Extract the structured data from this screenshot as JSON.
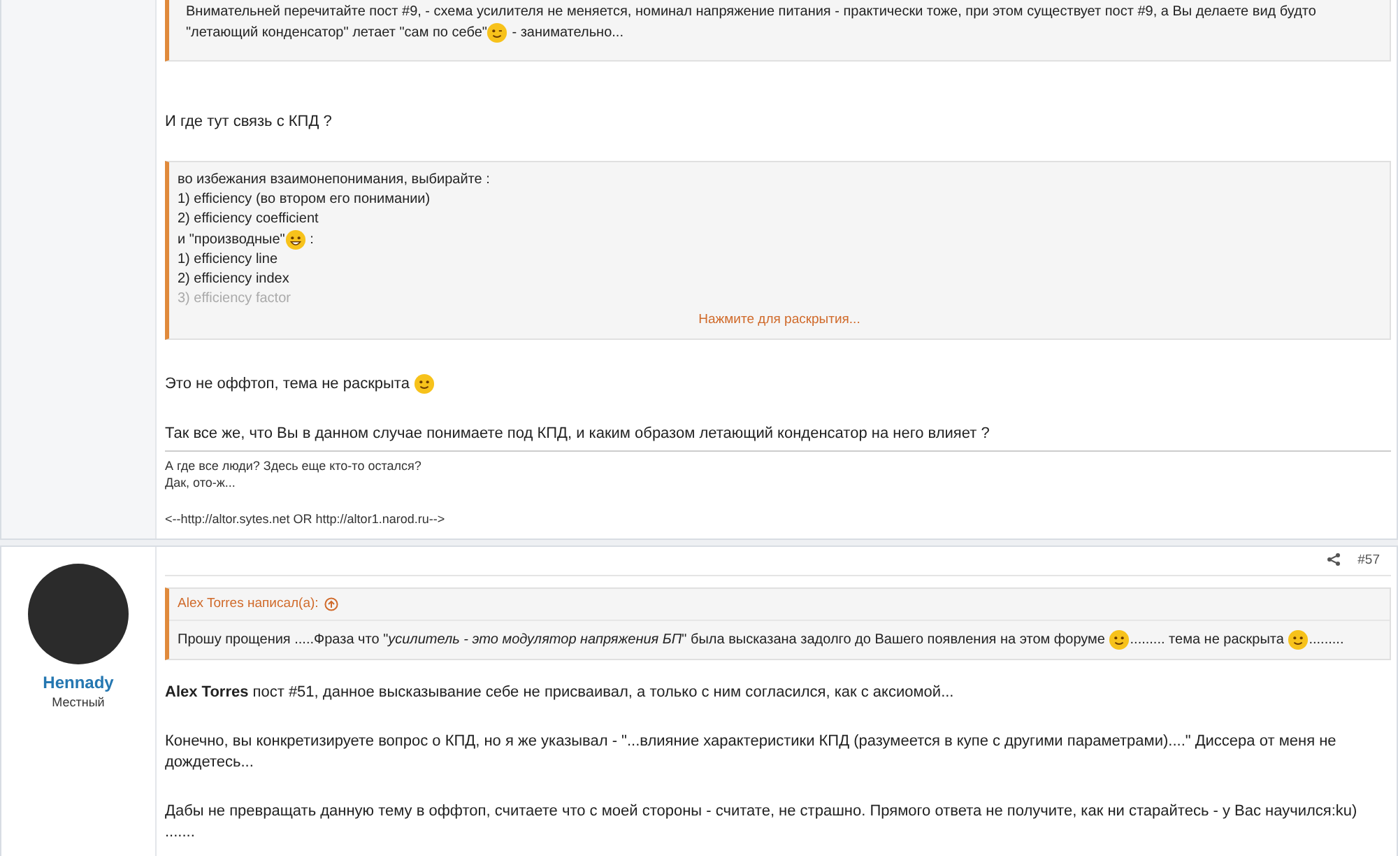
{
  "posts": [
    {
      "kind": "continued",
      "blocks": [
        {
          "kind": "quote",
          "paragraphs": [
            [
              {
                "kind": "text",
                "text": "Внимательней перечитайте пост #9, - схема усилителя не меняется, номинал напряжение питания - практически тоже, при этом существует пост #9, а Вы делаете вид будто \"летающий конденсатор\" летает \"сам по себе\""
              },
              {
                "kind": "wink"
              },
              {
                "kind": "text",
                "text": " - занимательно..."
              }
            ]
          ]
        },
        {
          "kind": "text",
          "paragraphs": [
            [
              {
                "kind": "text",
                "text": "И где тут связь с КПД ?"
              }
            ]
          ]
        },
        {
          "kind": "expandable",
          "expanded": false,
          "expander": "Нажмите для раскрытия...",
          "paragraphs": [
            [
              {
                "kind": "text",
                "text": "во избежания взаимонепонимания, выбирайте :"
              }
            ],
            [
              {
                "kind": "text",
                "text": "1) efficiency (во втором его понимании)"
              }
            ],
            [
              {
                "kind": "text",
                "text": "2) efficiency coefficient"
              }
            ],
            [
              {
                "kind": "text",
                "text": "и \"производные\""
              },
              {
                "kind": "grin"
              },
              {
                "kind": "text",
                "text": " :"
              }
            ],
            [
              {
                "kind": "text",
                "text": "1) efficiency line"
              }
            ],
            [
              {
                "kind": "text",
                "text": "2) efficiency index"
              }
            ],
            [
              {
                "kind": "text",
                "text": "3) efficiency factor"
              }
            ]
          ]
        },
        {
          "kind": "text",
          "paragraphs": [
            [
              {
                "kind": "text",
                "text": "Это не оффтоп, тема не раскрыта "
              },
              {
                "kind": "smile"
              }
            ],
            [
              {
                "kind": "text",
                "text": "Так все же, что Вы в данном случае понимаете под КПД, и каким образом летающий конденсатор на него влияет ?"
              }
            ]
          ]
        }
      ],
      "signature": [
        [
          "А где все люди? Здесь еще кто-то остался?",
          "Дак, ото-ж..."
        ],
        [
          "<--http://altor.sytes.net OR http://altor1.narod.ru-->"
        ]
      ]
    },
    {
      "kind": "full",
      "author": "Hennady",
      "rank": "Местный",
      "number": "#57",
      "blocks": [
        {
          "kind": "quote",
          "attribution": "Alex Torres написал(а):",
          "paragraphs": [
            [
              {
                "kind": "text",
                "text": "Прошу прощения .....Фраза что \"*усилитель - это модулятор напряжения БП*\" была высказана задолго до Вашего появления на этом форуме "
              },
              {
                "kind": "smile"
              },
              {
                "kind": "text",
                "text": "......... тема не раскрыта "
              },
              {
                "kind": "smile"
              },
              {
                "kind": "text",
                "text": "........."
              }
            ]
          ]
        },
        {
          "kind": "text",
          "paragraphs": [
            [
              {
                "kind": "text",
                "text": "**Alex Torres** пост #51, данное высказывание себе не присваивал, а только с ним согласился, как с аксиомой..."
              }
            ],
            [
              {
                "kind": "text",
                "text": "Конечно, вы конкретизируете вопрос о КПД, но я же указывал - \"...влияние характеристики КПД (разумеется в купе с другими параметрами)....\" Диссера от меня не дождетесь..."
              }
            ],
            [
              {
                "kind": "text",
                "text": "Дабы не превращать данную тему в оффтоп, считаете что с моей стороны - считате, не страшно. Прямого ответа не получите, как ни старайтесь - у Вас научился:ku) ......."
              }
            ]
          ]
        }
      ]
    }
  ]
}
